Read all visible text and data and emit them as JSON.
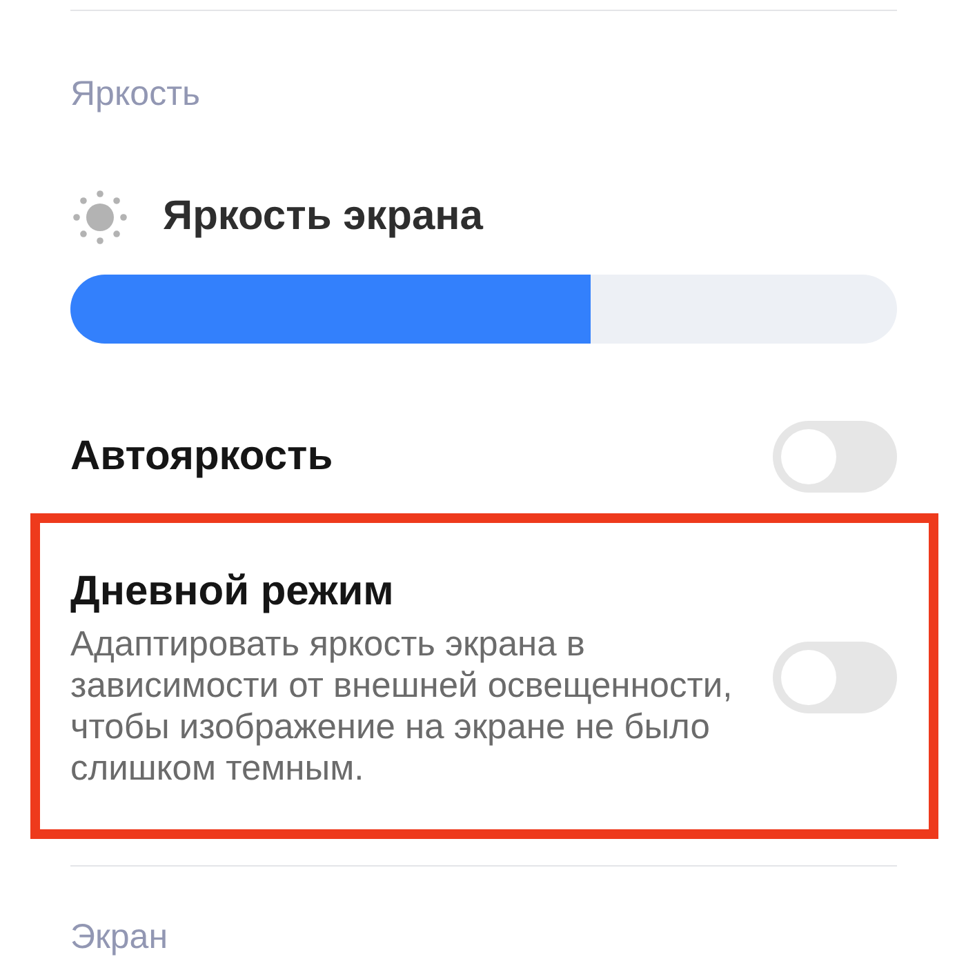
{
  "brightness_section": {
    "header": "Яркость",
    "slider": {
      "label": "Яркость экрана",
      "level": 0.63
    },
    "rows": [
      {
        "title": "Автояркость",
        "on": false,
        "highlighted": false
      },
      {
        "title": "Дневной режим",
        "description": "Адаптировать яркость экрана в зависимости от внешней освещенности, чтобы изображение на экране не было слишком темным.",
        "on": false,
        "highlighted": true
      }
    ]
  },
  "next_section": {
    "header": "Экран"
  }
}
